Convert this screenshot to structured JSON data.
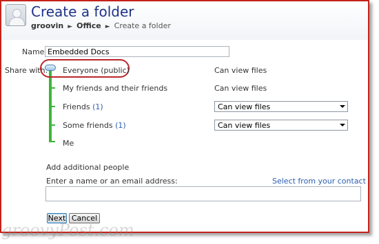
{
  "header": {
    "title": "Create a folder",
    "breadcrumb": [
      "groovin",
      "Office",
      "Create a folder"
    ]
  },
  "form": {
    "name_label": "Name:",
    "name_value": "Embedded Docs",
    "share_label": "Share with:"
  },
  "share_options": [
    {
      "label": "Everyone (public)",
      "count": "",
      "permission": "Can view files",
      "is_dropdown": false
    },
    {
      "label": "My friends and their friends",
      "count": "",
      "permission": "Can view files",
      "is_dropdown": false
    },
    {
      "label": "Friends",
      "count": "(1)",
      "permission": "Can view files",
      "is_dropdown": true
    },
    {
      "label": "Some friends",
      "count": "(1)",
      "permission": "Can view files",
      "is_dropdown": true
    },
    {
      "label": "Me",
      "count": "",
      "permission": "",
      "is_dropdown": false
    }
  ],
  "add_people": {
    "title": "Add additional people",
    "prompt": "Enter a name or an email address:",
    "contact_link": "Select from your contact list",
    "input_value": ""
  },
  "buttons": {
    "next": "Next",
    "cancel": "Cancel"
  },
  "watermark": "groovyPost.com",
  "colors": {
    "title": "#1e3287",
    "link": "#2a5db0",
    "slider": "#3db43a",
    "highlight_circle": "#b8262c",
    "frame": "#c4221b"
  }
}
